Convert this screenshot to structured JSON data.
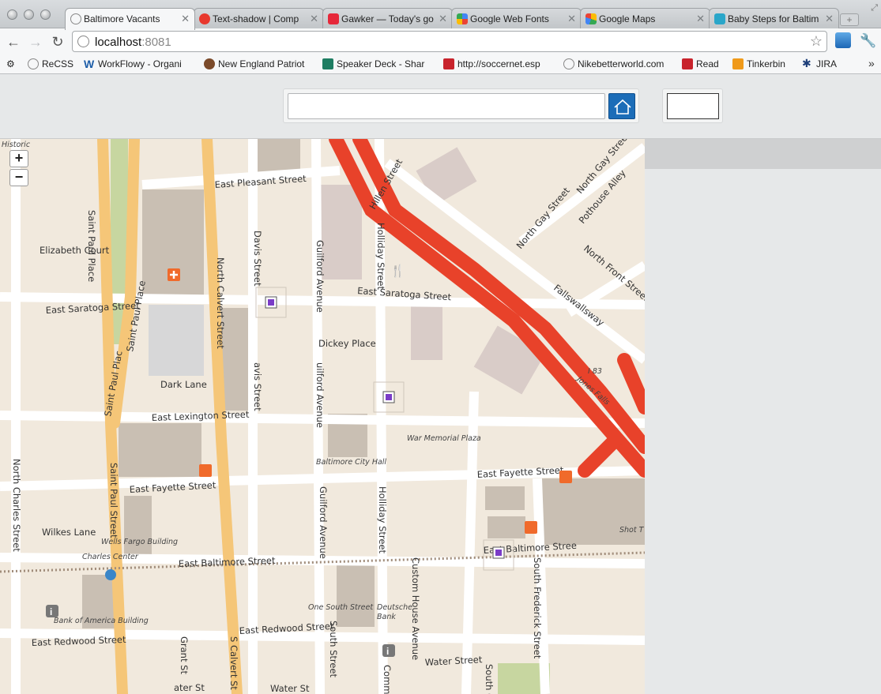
{
  "browser": {
    "tabs": [
      {
        "title": "Baltimore Vacants",
        "active": true
      },
      {
        "title": "Text-shadow | Comp",
        "active": false
      },
      {
        "title": "Gawker — Today's go",
        "active": false
      },
      {
        "title": "Google Web Fonts",
        "active": false
      },
      {
        "title": "Google Maps",
        "active": false
      },
      {
        "title": "Baby Steps for Baltim",
        "active": false
      }
    ],
    "url_host": "localhost",
    "url_port": ":8081",
    "bookmarks": [
      "ReCSS",
      "WorkFlowy - Organi",
      "New England Patriot",
      "Speaker Deck - Shar",
      "http://soccernet.esp",
      "Nikebetterworld.com",
      "Read",
      "Tinkerbin",
      "JIRA"
    ],
    "bookmarks_more": "»"
  },
  "page": {
    "search": {
      "value": "",
      "placeholder": ""
    },
    "home_icon": "home-icon"
  },
  "map": {
    "zoom_in": "+",
    "zoom_out": "−",
    "streets": {
      "east_pleasant": "East Pleasant Street",
      "saint_paul_place": "Saint Paul Place",
      "elizabeth_court": "Elizabeth Court",
      "north_calvert": "North Calvert Street",
      "davis": "Davis Street",
      "guilford": "Guilford Avenue",
      "holliday": "Holliday Street",
      "hillen": "Hillen Street",
      "north_gay": "North Gay Street",
      "north_gay2": "North Gay Street",
      "pothouse": "Pothouse Alley",
      "north_front": "North Front Street",
      "fallsway": "Fallswallsway",
      "east_saratoga": "East Saratoga Street",
      "east_saratoga2": "East Saratoga Street",
      "saint_paul_place2": "Saint Paul Place",
      "dickey": "Dickey Place",
      "dark_lane": "Dark Lane",
      "davis2": "avis Street",
      "guilford2": "uilford Avenue",
      "east_lexington": "East Lexington Street",
      "saint_paul_plac": "Saint Paul Plac",
      "war_memorial": "War Memorial Plaza",
      "city_hall": "Baltimore City Hall",
      "east_fayette": "East Fayette Street",
      "east_fayette2": "East Fayette Street",
      "north_charles": "North Charles Street",
      "saint_paul_street": "Saint Paul Street",
      "guilford3": "Guilford Avenue",
      "holliday2": "Holliday Street",
      "wilkes": "Wilkes Lane",
      "wells_fargo": "Wells Fargo Building",
      "charles_center": "Charles Center",
      "east_baltimore": "East Baltimore Street",
      "east_baltimore2": "East Baltimore Stree",
      "south_frederick": "South Frederick Street",
      "custom_house": "Custom House Avenue",
      "shot_tower": "Shot T",
      "bank_of_america": "Bank of America Building",
      "one_south": "One South Street",
      "deutsche": "Deutsche",
      "deutsche_bank": "Bank",
      "east_redwood": "East Redwood Street",
      "east_redwood2": "East Redwood Street",
      "south_street": "South Street",
      "s_calvert": "S Calvert St",
      "grant": "Grant St",
      "water": "Water Street",
      "water2": "Water St",
      "water3": "ater St",
      "commerce": "Comm",
      "south_g": "South G",
      "historic": "Historic",
      "route": "I 83",
      "jones_falls": "Jones Falls"
    }
  }
}
